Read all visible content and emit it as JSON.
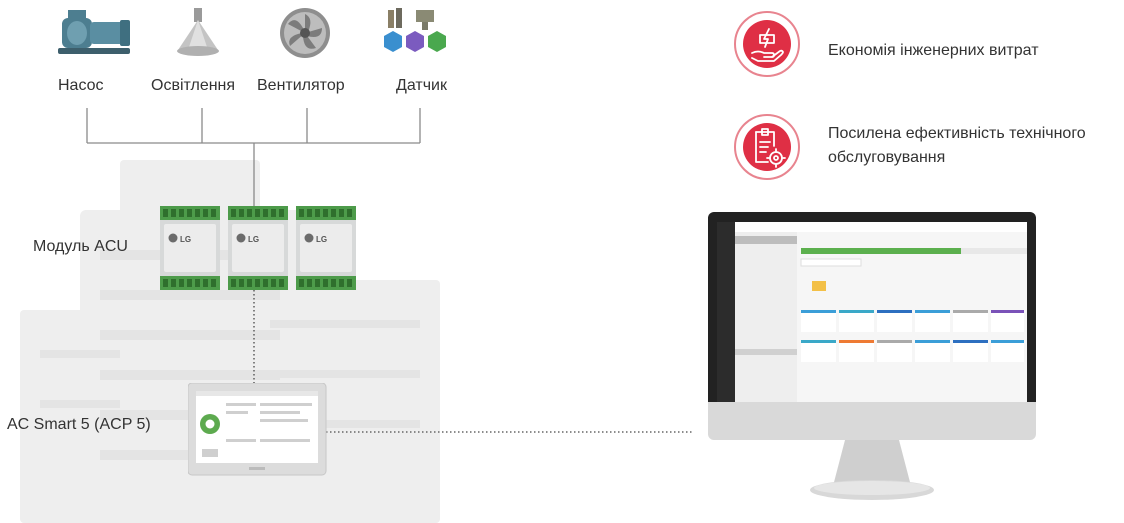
{
  "devices": {
    "pump": "Насос",
    "lighting": "Освітлення",
    "fan": "Вентилятор",
    "sensor": "Датчик"
  },
  "acu_label": "Модуль ACU",
  "acp_label": "AC Smart 5 (ACP 5)",
  "benefits": {
    "engineering": "Економія інженерних витрат",
    "maintenance": "Посилена ефективність технічного обслуговування"
  },
  "brand": "LG",
  "colors": {
    "accent": "#df2f45",
    "line": "#8a8a8a"
  },
  "icons": [
    "pump-icon",
    "lighting-icon",
    "fan-icon",
    "sensor-icon",
    "cost-saving-icon",
    "maintenance-icon"
  ]
}
